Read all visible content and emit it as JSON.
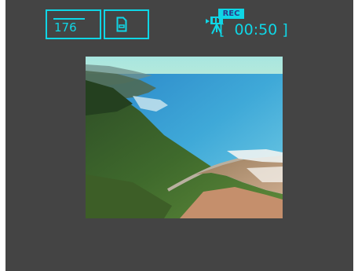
{
  "osd": {
    "image_size": "176",
    "storage_icon": "memory-card-icon",
    "mode_icon": "movie-camera-icon",
    "rec_label": "REC",
    "timer_open": "[",
    "timer_value": "00:50",
    "timer_close": "]"
  },
  "colors": {
    "osd": "#0fd6e6",
    "screen_bg": "#444444",
    "rec_text": "#2a3a8a"
  },
  "preview": {
    "subject": "coastal-landscape-image"
  }
}
